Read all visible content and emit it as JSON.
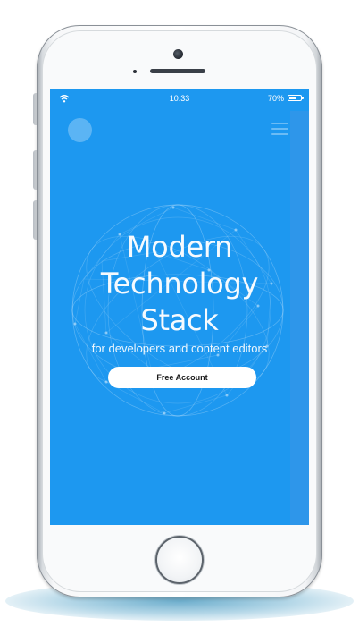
{
  "status_bar": {
    "time": "10:33",
    "battery_percent": "70%",
    "battery_level": 0.7,
    "wifi_icon": "wifi-icon"
  },
  "nav": {
    "logo_icon": "circle-logo-icon",
    "menu_icon": "hamburger-menu-icon"
  },
  "hero": {
    "title_lines": [
      "Modern",
      "Technology",
      "Stack"
    ],
    "subtitle": "for developers and content editors",
    "cta_label": "Free Account",
    "background_icon": "network-globe-icon"
  },
  "colors": {
    "screen_background": "#1d98f0",
    "button_background": "#ffffff",
    "text": "#ffffff"
  }
}
